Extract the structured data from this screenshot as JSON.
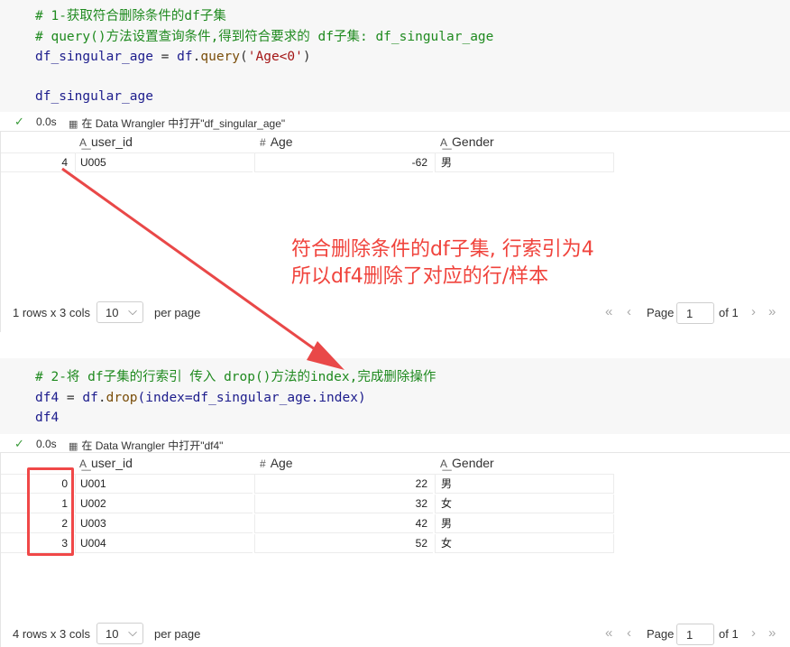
{
  "cell1": {
    "code": {
      "comment1": "# 1-获取符合删除条件的df子集",
      "comment2": "# query()方法设置查询条件,得到符合要求的 df子集: df_singular_age",
      "line3_var": "df_singular_age",
      "line3_eq": " = ",
      "line3_obj": "df",
      "line3_dot": ".",
      "line3_fn": "query",
      "line3_open": "(",
      "line3_str": "'Age<0'",
      "line3_close": ")",
      "line5": "df_singular_age"
    },
    "status": {
      "time": "0.0s",
      "wrangler": "在 Data Wrangler 中打开\"df_singular_age\""
    },
    "table": {
      "headers": [
        "user_id",
        "Age",
        "Gender"
      ],
      "rows": [
        {
          "index": "4",
          "user_id": "U005",
          "age": "-62",
          "gender": "男"
        }
      ]
    },
    "pager": {
      "info": "1 rows x 3 cols",
      "per_page_value": "10",
      "per_page_label": "per page",
      "page_label": "Page",
      "page_value": "1",
      "of_label": "of 1"
    }
  },
  "cell2": {
    "code": {
      "comment1": "# 2-将 df子集的行索引 传入 drop()方法的index,完成删除操作",
      "line2_var": "df4",
      "line2_eq": " = ",
      "line2_obj": "df",
      "line2_dot": ".",
      "line2_fn": "drop",
      "line2_args": "(index=df_singular_age.index)",
      "line3": "df4"
    },
    "status": {
      "time": "0.0s",
      "wrangler": "在 Data Wrangler 中打开\"df4\""
    },
    "table": {
      "headers": [
        "user_id",
        "Age",
        "Gender"
      ],
      "rows": [
        {
          "index": "0",
          "user_id": "U001",
          "age": "22",
          "gender": "男"
        },
        {
          "index": "1",
          "user_id": "U002",
          "age": "32",
          "gender": "女"
        },
        {
          "index": "2",
          "user_id": "U003",
          "age": "42",
          "gender": "男"
        },
        {
          "index": "3",
          "user_id": "U004",
          "age": "52",
          "gender": "女"
        }
      ]
    },
    "pager": {
      "info": "4 rows x 3 cols",
      "per_page_value": "10",
      "per_page_label": "per page",
      "page_label": "Page",
      "page_value": "1",
      "of_label": "of 1"
    }
  },
  "annotation": {
    "line1": "符合删除条件的df子集, 行索引为4",
    "line2": "所以df4删除了对应的行/样本",
    "color": "#f0433c"
  },
  "icons": {
    "check": "check-icon",
    "wrangler": "data-wrangler-icon",
    "string_type": "string-type-icon",
    "number_type": "number-type-icon"
  }
}
